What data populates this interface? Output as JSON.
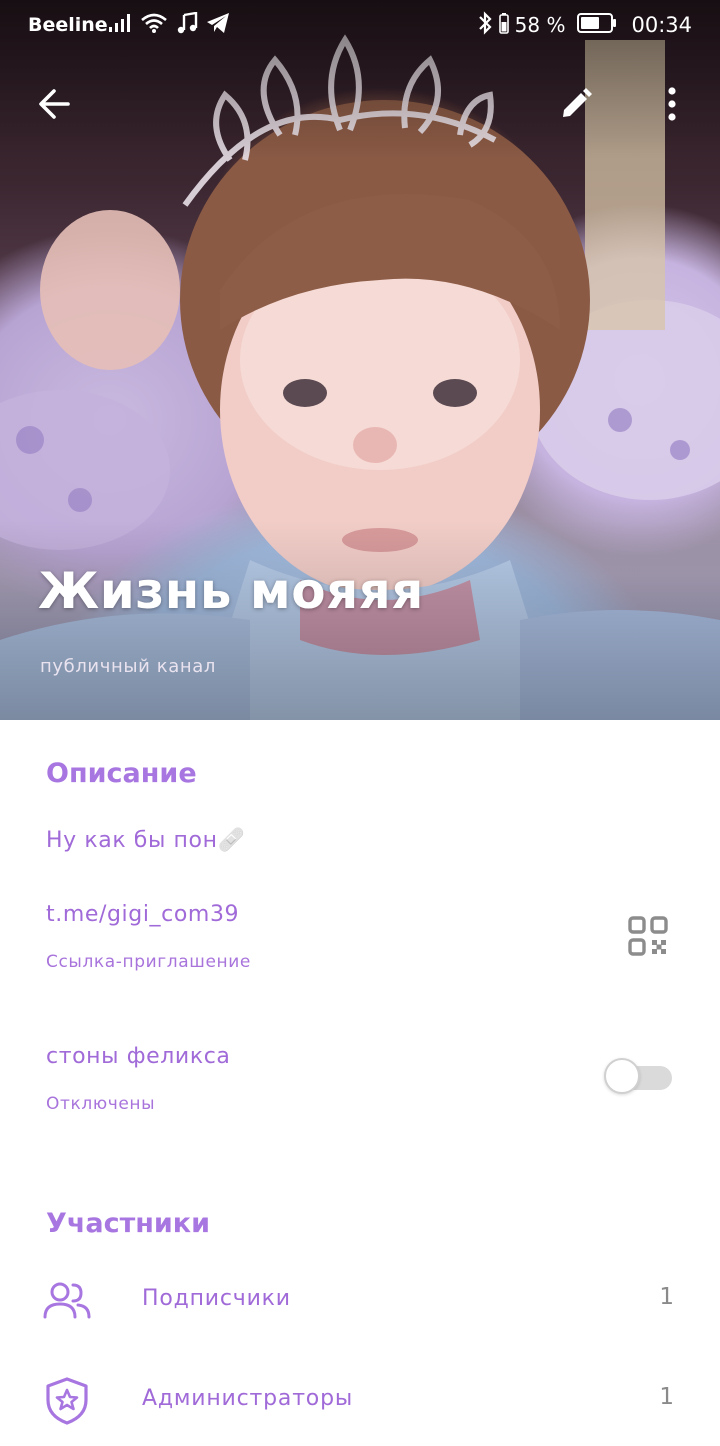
{
  "status_bar": {
    "carrier": "Beeline",
    "battery_percent": "58 %",
    "time": "00:34"
  },
  "header": {
    "title": "Жизнь мояяя",
    "subtitle": "публичный канал"
  },
  "description": {
    "section_title": "Описание",
    "text": "Ну как бы пон🩹"
  },
  "invite_link": {
    "url": "t.me/gigi_com39",
    "label": "Ссылка-приглашение"
  },
  "notifications": {
    "name": "стоны феликса",
    "status": "Отключены",
    "enabled": false
  },
  "members": {
    "section_title": "Участники",
    "items": [
      {
        "icon": "people-icon",
        "label": "Подписчики",
        "count": "1"
      },
      {
        "icon": "shield-star-icon",
        "label": "Администраторы",
        "count": "1"
      }
    ]
  },
  "colors": {
    "accent": "#a876e0",
    "toggle_off": "#dadada"
  }
}
